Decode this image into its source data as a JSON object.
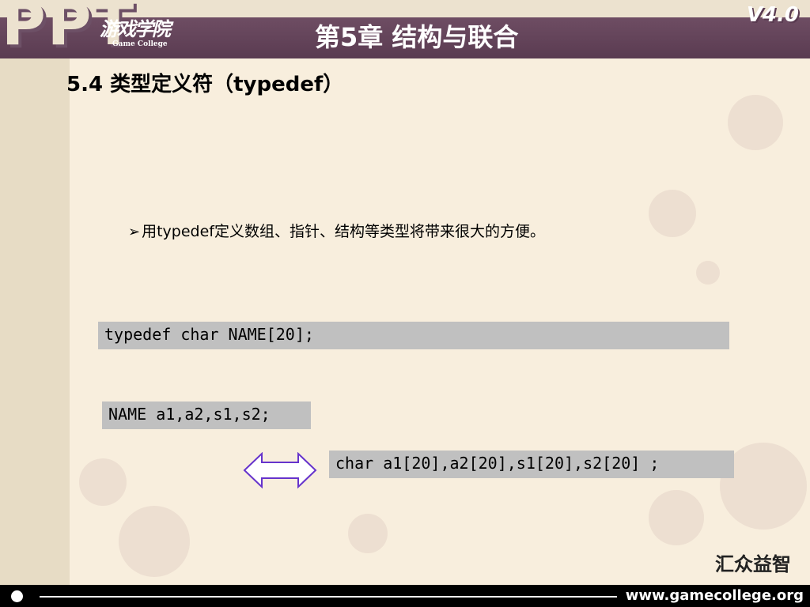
{
  "header": {
    "logo_cn": "游戏学院",
    "logo_en": "Game College",
    "chapter_title": "第5章 结构与联合",
    "version": "V4.0",
    "watermark": "PPT"
  },
  "section": {
    "title": "5.4 类型定义符（typedef）"
  },
  "content": {
    "bullet_text": "用typedef定义数组、指针、结构等类型将带来很大的方便。",
    "code_typedef": "typedef char NAME[20];",
    "code_usage": "NAME a1,a2,s1,s2;",
    "code_equivalent": "char a1[20],a2[20],s1[20],s2[20] ;"
  },
  "footer": {
    "brand": "汇众益智",
    "url": "www.gamecollege.org"
  },
  "icons": {
    "bullet": "arrowhead-bullet-icon",
    "equivalence": "double-arrow-icon"
  },
  "colors": {
    "header": "#5a3b51",
    "background": "#f8eedd",
    "code_bg": "#c0c0c0",
    "arrow": "#6633cc"
  }
}
